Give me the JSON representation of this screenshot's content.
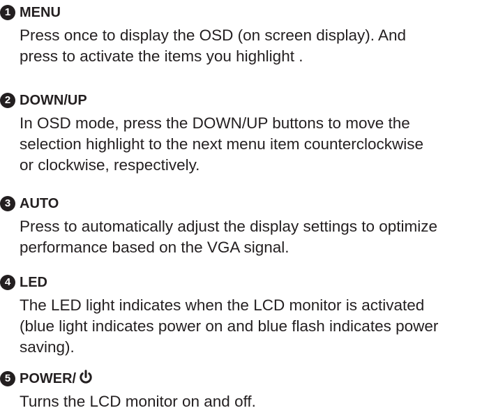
{
  "sections": [
    {
      "number": "1",
      "title": "MENU",
      "lines": [
        "Press once to display the OSD (on screen display). And",
        "press to activate the items you highlight ."
      ]
    },
    {
      "number": "2",
      "title": "DOWN/UP",
      "lines": [
        "In OSD mode, press the DOWN/UP buttons to move the",
        "selection highlight to the next menu item counterclockwise",
        "or clockwise, respectively."
      ]
    },
    {
      "number": "3",
      "title": "AUTO",
      "lines": [
        "Press to automatically adjust the display settings to optimize",
        "performance based on the VGA signal."
      ]
    },
    {
      "number": "4",
      "title": "LED",
      "lines": [
        "The LED light indicates when the LCD monitor is activated",
        "(blue light indicates power on and blue flash indicates power",
        "saving)."
      ]
    },
    {
      "number": "5",
      "title": "POWER/",
      "title_icon": "power-icon",
      "lines": [
        "Turns the LCD monitor on and off."
      ]
    }
  ]
}
